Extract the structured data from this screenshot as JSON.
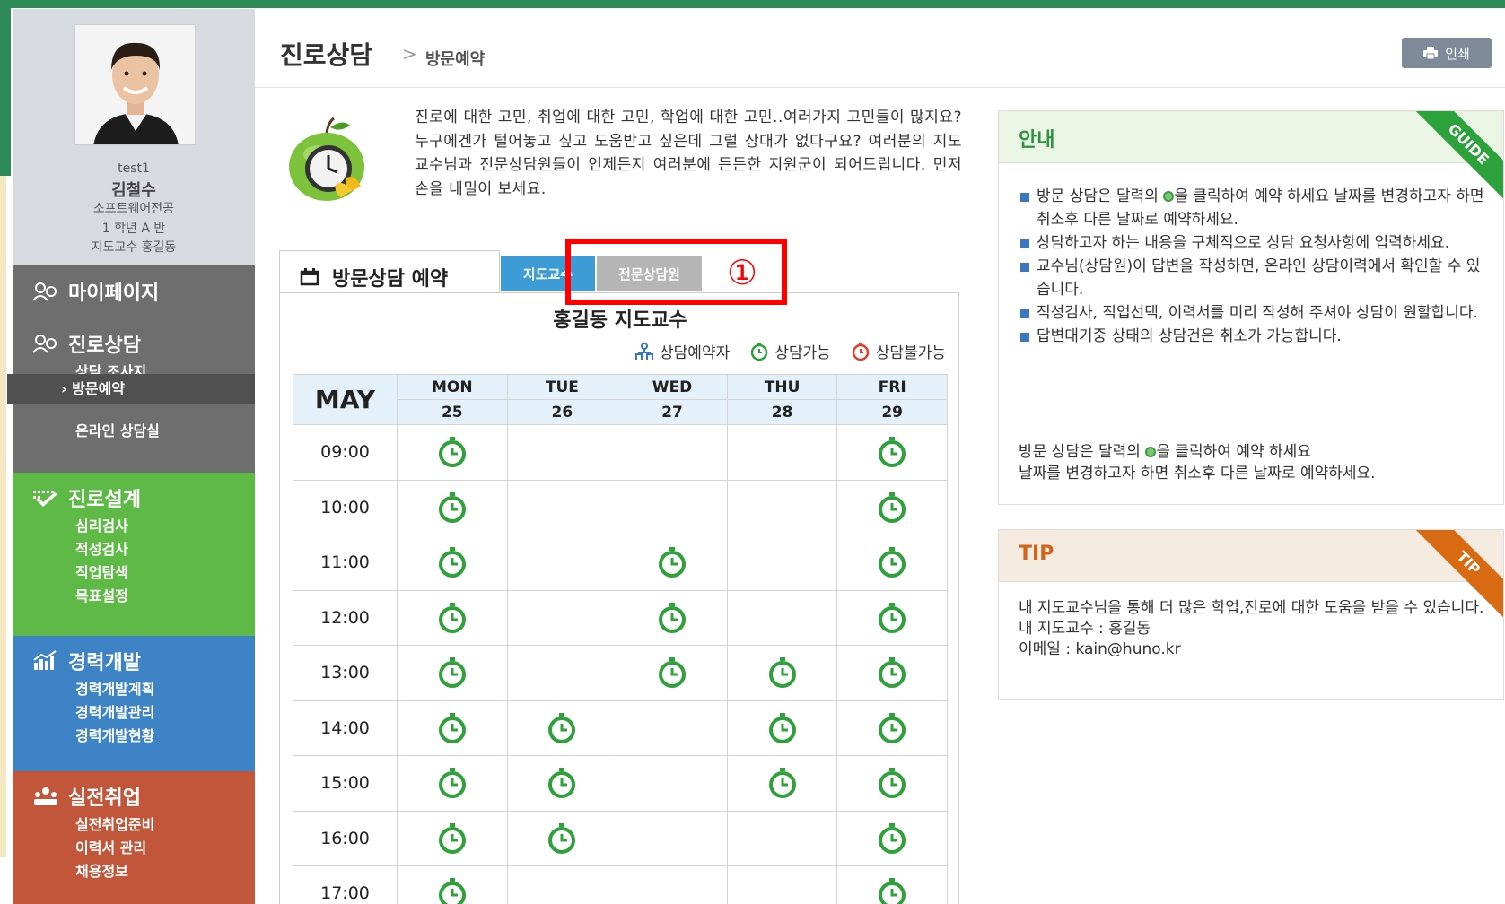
{
  "profile": {
    "user_id": "test1",
    "name": "김철수",
    "major": "소프트웨어전공",
    "grade": "1 학년 A 반",
    "advisor": "지도교수 홍길동"
  },
  "sidebar": {
    "mypage": "마이페이지",
    "career_counsel": "진로상담",
    "counsel_survey": "상담 조사지",
    "visit_reservation": "› 방문예약",
    "online_counsel": "온라인 상담실",
    "career_design": "진로설계",
    "design_items": [
      "심리검사",
      "적성검사",
      "직업탐색",
      "목표설정"
    ],
    "career_dev": "경력개발",
    "dev_items": [
      "경력개발계획",
      "경력개발관리",
      "경력개발현황"
    ],
    "job": "실전취업",
    "job_items": [
      "실전취업준비",
      "이력서 관리",
      "채용정보"
    ]
  },
  "header": {
    "title": "진로상담",
    "separator": ">",
    "breadcrumb": "방문예약",
    "print_label": "인쇄"
  },
  "intro": {
    "text": "진로에 대한 고민, 취업에 대한 고민, 학업에 대한 고민..여러가지 고민들이 많지요? 누구에겐가 털어놓고 싶고 도움받고 싶은데 그럴 상대가 없다구요? 여러분의 지도교수님과 전문상담원들이 언제든지 여러분에 든든한 지원군이 되어드립니다. 먼저 손을 내밀어 보세요."
  },
  "reservation": {
    "tab_title": "방문상담 예약",
    "tab_professor": "지도교수",
    "tab_counselor": "전문상담원",
    "marker": "①",
    "panel_title": "홍길동 지도교수",
    "legend": {
      "reserved": "상담예약자",
      "available": "상담가능",
      "unavailable": "상담불가능"
    },
    "month": "MAY",
    "days": [
      {
        "name": "MON",
        "date": "25"
      },
      {
        "name": "TUE",
        "date": "26"
      },
      {
        "name": "WED",
        "date": "27"
      },
      {
        "name": "THU",
        "date": "28"
      },
      {
        "name": "FRI",
        "date": "29"
      }
    ],
    "times": [
      "09:00",
      "10:00",
      "11:00",
      "12:00",
      "13:00",
      "14:00",
      "15:00",
      "16:00",
      "17:00"
    ],
    "slots": [
      [
        true,
        false,
        false,
        false,
        true
      ],
      [
        true,
        false,
        false,
        false,
        true
      ],
      [
        true,
        false,
        true,
        false,
        true
      ],
      [
        true,
        false,
        true,
        false,
        true
      ],
      [
        true,
        false,
        true,
        true,
        true
      ],
      [
        true,
        true,
        false,
        true,
        true
      ],
      [
        true,
        true,
        false,
        true,
        true
      ],
      [
        true,
        true,
        false,
        false,
        true
      ],
      [
        true,
        false,
        false,
        false,
        true
      ]
    ],
    "available_color": "#2fa13a",
    "unavailable_color": "#e0402a",
    "reserved_color": "#3a77c2"
  },
  "guide": {
    "title": "안내",
    "ribbon": "GUIDE",
    "items": [
      {
        "pre": "방문 상담은 달력의 ",
        "post": "을 클릭하여 예약 하세요 날짜를 변경하고자 하면 취소후 다른 날짜로 예약하세요."
      },
      {
        "pre": "상담하고자 하는 내용을 구체적으로 상담 요청사항에 입력하세요.",
        "post": ""
      },
      {
        "pre": "교수님(상담원)이 답변을 작성하면, 온라인 상담이력에서 확인할 수 있습니다.",
        "post": ""
      },
      {
        "pre": "적성검사, 직업선택, 이력서를 미리 작성해 주셔야 상담이 원할합니다.",
        "post": ""
      },
      {
        "pre": "답변대기중 상태의 상담건은 취소가 가능합니다.",
        "post": ""
      }
    ],
    "note_pre": "방문 상담은 달력의 ",
    "note_post": "을 클릭하여 예약 하세요",
    "note_line2": "날짜를 변경하고자 하면 취소후 다른 날짜로 예약하세요."
  },
  "tip": {
    "title": "TIP",
    "ribbon": "TIP",
    "line1": "내 지도교수님을 통해 더 많은 학업,진로에 대한 도움을 받을 수 있습니다.",
    "line2": "내 지도교수 : 홍길동",
    "line3": "이메일 : kain@huno.kr"
  }
}
